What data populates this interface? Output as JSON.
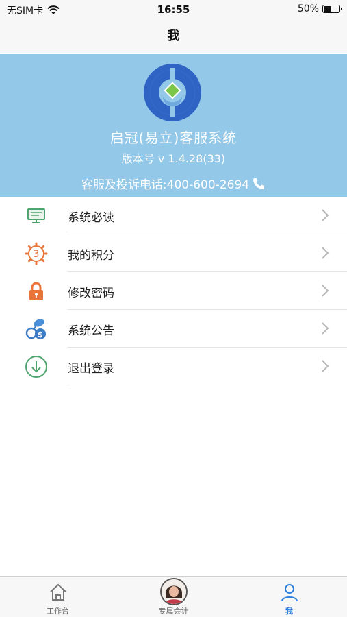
{
  "status_bar": {
    "carrier": "无SIM卡",
    "time": "16:55",
    "battery_percent": "50%",
    "battery_level": 0.5
  },
  "nav": {
    "title": "我"
  },
  "banner": {
    "app_name": "启冠(易立)客服系统",
    "version": "版本号 v 1.4.28(33)",
    "hotline": "客服及投诉电话:400-600-2694",
    "bg_color": "#93c8e8"
  },
  "menu": {
    "items": [
      {
        "label": "系统必读",
        "icon": "monitor-icon"
      },
      {
        "label": "我的积分",
        "icon": "points-icon",
        "badge": "3"
      },
      {
        "label": "修改密码",
        "icon": "lock-icon"
      },
      {
        "label": "系统公告",
        "icon": "coins-icon"
      },
      {
        "label": "退出登录",
        "icon": "download-circle-icon"
      }
    ]
  },
  "tab_bar": {
    "tabs": [
      {
        "label": "工作台",
        "icon": "home-icon"
      },
      {
        "label": "专属会计",
        "icon": "avatar"
      },
      {
        "label": "我",
        "icon": "person-icon",
        "active": true
      }
    ],
    "active_color": "#2f7fe0"
  }
}
